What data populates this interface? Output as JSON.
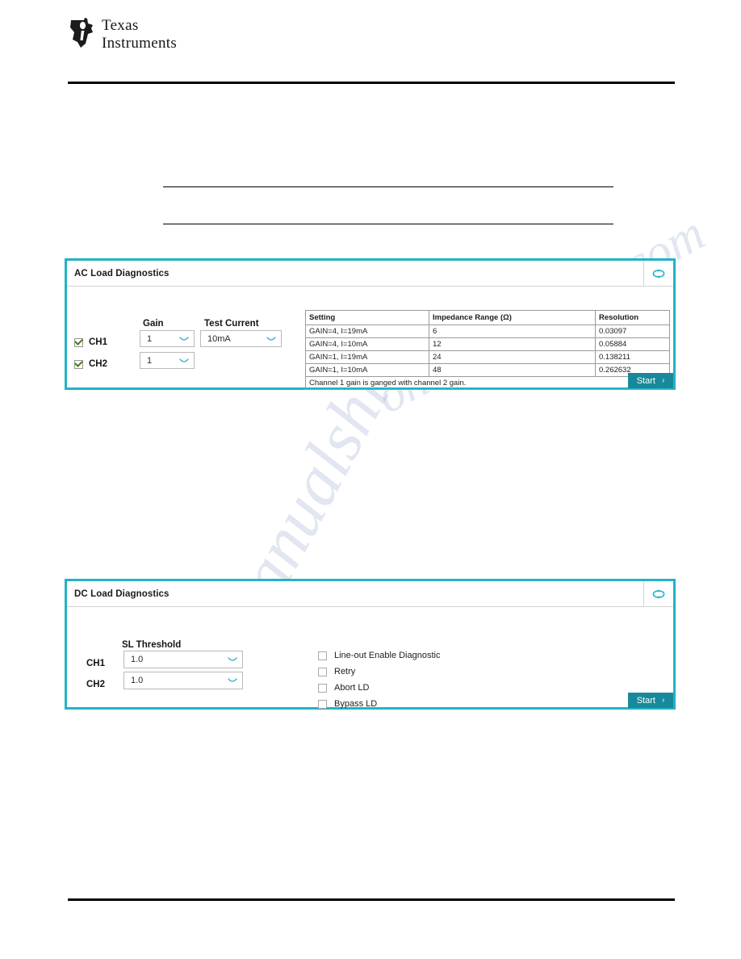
{
  "brand": {
    "line1": "Texas",
    "line2": "Instruments"
  },
  "watermark": {
    "text_a": "onanualshive.com",
    "text_b": "manualshive"
  },
  "ac_panel": {
    "title": "AC Load Diagnostics",
    "refresh_icon": "loop-refresh-icon",
    "labels": {
      "gain": "Gain",
      "test_current": "Test Current"
    },
    "channels": [
      {
        "name": "CH1",
        "checked": true,
        "gain": "1"
      },
      {
        "name": "CH2",
        "checked": true,
        "gain": "1"
      }
    ],
    "test_current_value": "10mA",
    "table": {
      "headers": [
        "Setting",
        "Impedance Range (Ω)",
        "Resolution"
      ],
      "rows": [
        [
          "GAIN=4, I=19mA",
          "6",
          "0.03097"
        ],
        [
          "GAIN=4, I=10mA",
          "12",
          "0.05884"
        ],
        [
          "GAIN=1, I=19mA",
          "24",
          "0.138211"
        ],
        [
          "GAIN=1, I=10mA",
          "48",
          "0.262632"
        ]
      ],
      "note": "Channel 1 gain is ganged with channel 2 gain."
    },
    "start_label": "Start",
    "start_chevron": "›"
  },
  "dc_panel": {
    "title": "DC Load Diagnostics",
    "refresh_icon": "loop-refresh-icon",
    "labels": {
      "sl_threshold": "SL Threshold"
    },
    "channels": [
      {
        "name": "CH1",
        "threshold": "1.0"
      },
      {
        "name": "CH2",
        "threshold": "1.0"
      }
    ],
    "options": [
      {
        "label": "Line-out Enable Diagnostic",
        "checked": false
      },
      {
        "label": "Retry",
        "checked": false
      },
      {
        "label": "Abort LD",
        "checked": false
      },
      {
        "label": "Bypass LD",
        "checked": false
      }
    ],
    "start_label": "Start",
    "start_chevron": "›"
  },
  "colors": {
    "panel_border": "#21b3c4",
    "button": "#18899b",
    "chevron": "#3fb6cf",
    "check": "#4a7a16"
  }
}
